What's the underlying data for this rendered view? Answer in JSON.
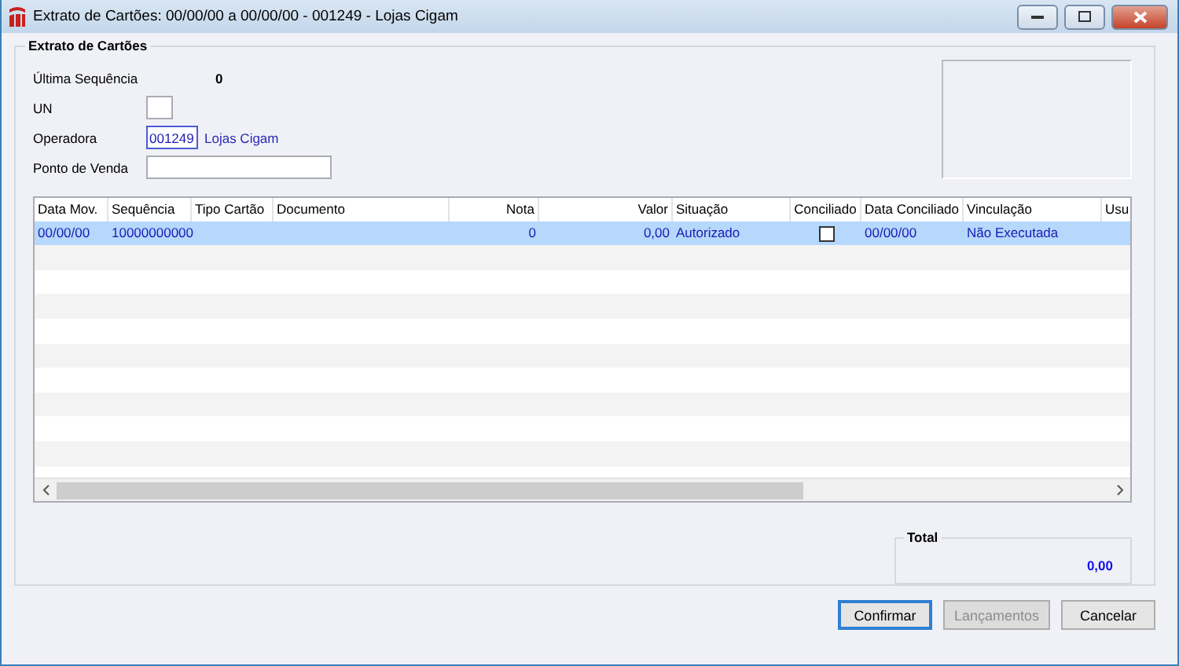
{
  "window": {
    "title": "Extrato de Cartões: 00/00/00 a 00/00/00 - 001249 - Lojas Cigam"
  },
  "group": {
    "title": "Extrato de Cartões"
  },
  "fields": [
    {
      "kind": "readout",
      "label": "Última Sequência",
      "value": "0"
    },
    {
      "kind": "input",
      "label": "UN"
    },
    {
      "kind": "code",
      "label": "Operadora",
      "value": "001249",
      "description": "Lojas Cigam"
    },
    {
      "kind": "wide",
      "label": "Ponto de Venda"
    }
  ],
  "table": {
    "columns": [
      "Data Mov.",
      "Sequência",
      "Tipo Cartão",
      "Documento",
      "Nota",
      "Valor",
      "Situação",
      "Conciliado",
      "Data Conciliado",
      "Vinculação",
      "Usu"
    ],
    "rows": [
      {
        "selected": true,
        "conciliado": false,
        "cells": [
          "00/00/00",
          "10000000000",
          "",
          "",
          "0",
          "0,00",
          "Autorizado",
          "",
          "00/00/00",
          "Não Executada",
          ""
        ]
      }
    ]
  },
  "total": {
    "title": "Total",
    "value": "0,00"
  },
  "buttons": [
    {
      "label": "Confirmar",
      "disabled": false,
      "default": true
    },
    {
      "label": "Lançamentos",
      "disabled": true,
      "default": false
    },
    {
      "label": "Cancelar",
      "disabled": false,
      "default": false
    }
  ]
}
